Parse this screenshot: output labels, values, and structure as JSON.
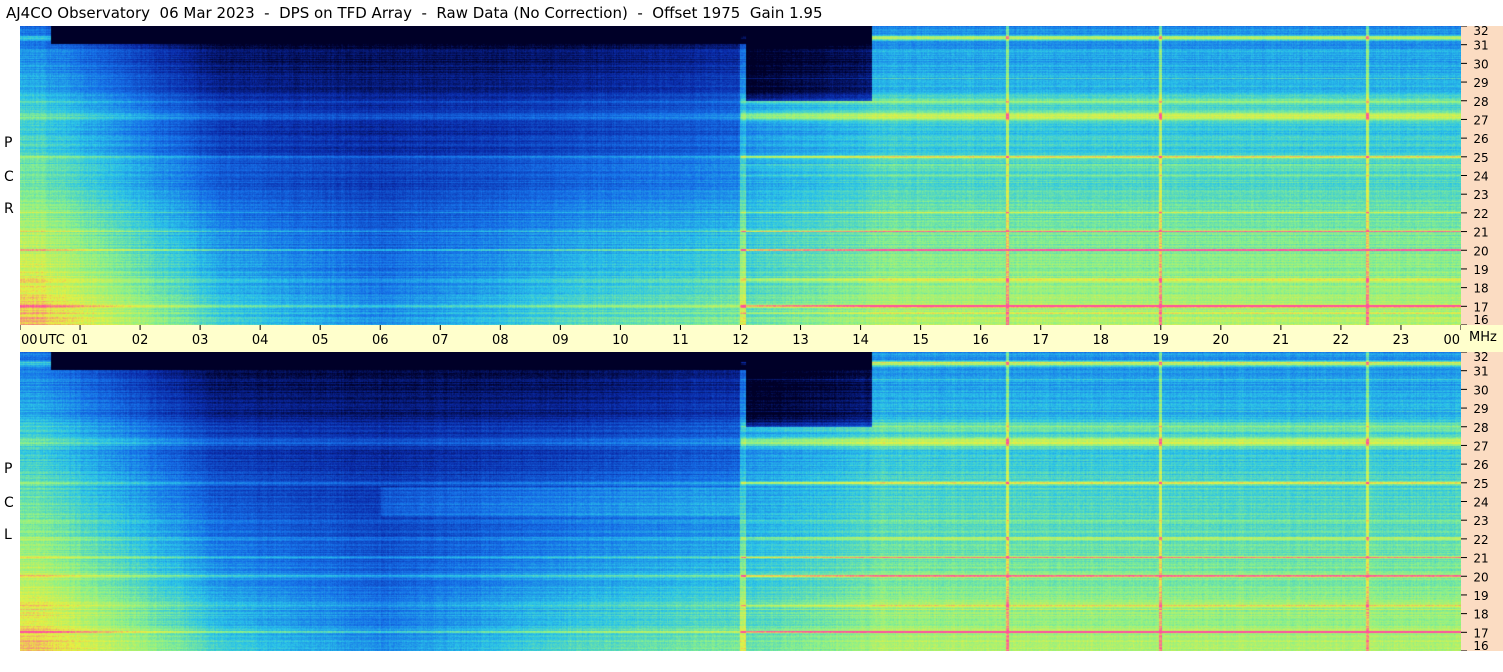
{
  "title": "AJ4CO Observatory  06 Mar 2023  -  DPS on TFD Array  -  Raw Data (No Correction)  -  Offset 1975  Gain 1.95",
  "panels": [
    {
      "label_letters": [
        "P",
        "C",
        "R"
      ]
    },
    {
      "label_letters": [
        "P",
        "C",
        "L"
      ]
    }
  ],
  "time_axis": {
    "ticks": [
      "00",
      "01",
      "02",
      "03",
      "04",
      "05",
      "06",
      "07",
      "08",
      "09",
      "10",
      "11",
      "12",
      "13",
      "14",
      "15",
      "16",
      "17",
      "18",
      "19",
      "20",
      "21",
      "22",
      "23",
      "00"
    ],
    "utc_label": "UTC",
    "mhz_label": "MHz"
  },
  "freq_axis": {
    "ticks": [
      "32",
      "31",
      "30",
      "29",
      "28",
      "27",
      "26",
      "25",
      "24",
      "23",
      "22",
      "21",
      "20",
      "19",
      "18",
      "17",
      "16"
    ]
  },
  "colors": {
    "background": "#ffffff",
    "time_axis_bg": "#ffffcc",
    "freq_axis_bg": "#fbdcc2"
  },
  "chart_data": {
    "type": "heatmap",
    "x_range_utc_hours": [
      0,
      24
    ],
    "y_range_mhz": [
      16,
      32
    ],
    "panels": [
      "RCP",
      "LCP"
    ],
    "colormap": [
      "#000028",
      "#0a2aa8",
      "#1670e8",
      "#2bc4e8",
      "#8cf08a",
      "#e8f040",
      "#ff4fa0"
    ],
    "vertical_interference_lines_utc": [
      16.45,
      19.0,
      22.45
    ],
    "strong_bands_mhz": [
      27.2,
      28.0,
      25.0,
      20.0,
      17.0
    ],
    "quiet_period_utc": [
      12.1,
      14.2
    ]
  }
}
